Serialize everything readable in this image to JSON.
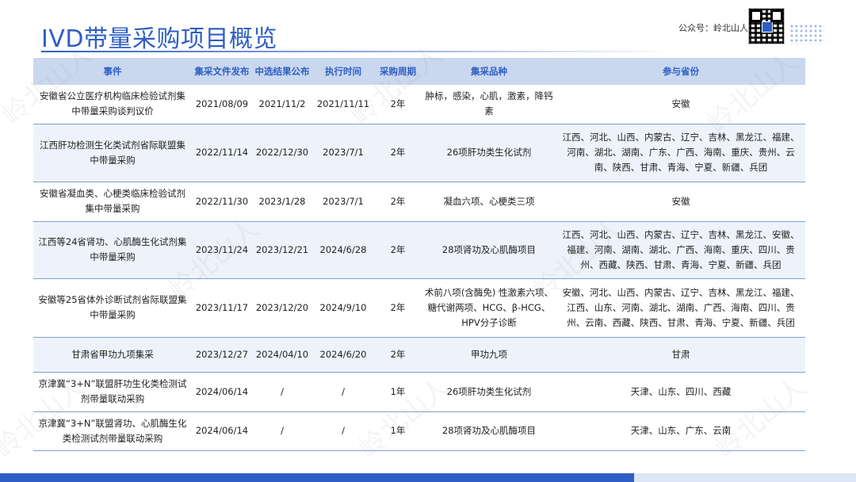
{
  "page": {
    "title": "IVD带量采购项目概览",
    "account_label": "公众号：岭北山人",
    "watermark": "岭北山人"
  },
  "table": {
    "headers": [
      "事件",
      "集采文件发布",
      "中选结果公布",
      "执行时间",
      "采购周期",
      "集采品种",
      "参与省份"
    ],
    "rows": [
      {
        "event": "安徽省公立医疗机构临床检验试剂集中带量采购谈判议价",
        "published": "2021/08/09",
        "result": "2021/11/2",
        "exec": "2021/11/11",
        "cycle": "2年",
        "items": "肿标，感染，心肌，激素，降钙素",
        "provinces": "安徽"
      },
      {
        "event": "江西肝功检测生化类试剂省际联盟集中带量采购",
        "published": "2022/11/14",
        "result": "2022/12/30",
        "exec": "2023/7/1",
        "cycle": "2年",
        "items": "26项肝功类生化试剂",
        "provinces": "江西、河北、山西、内蒙古、辽宁、吉林、黑龙江、福建、河南、湖北、湖南、广东、广西、海南、重庆、贵州、云南、陕西、甘肃、青海、宁夏、新疆、兵团"
      },
      {
        "event": "安徽省凝血类、心梗类临床检验试剂集中带量采购",
        "published": "2022/11/30",
        "result": "2023/1/28",
        "exec": "2023/7/1",
        "cycle": "2年",
        "items": "凝血六项、心梗类三项",
        "provinces": "安徽"
      },
      {
        "event": "江西等24省肾功、心肌酶生化试剂集中带量采购",
        "published": "2023/11/24",
        "result": "2023/12/21",
        "exec": "2024/6/28",
        "cycle": "2年",
        "items": "28项肾功及心肌酶项目",
        "provinces": "江西、河北、山西、内蒙古、辽宁、吉林、黑龙江、安徽、福建、河南、湖南、湖北、广西、海南、重庆、四川、贵州、西藏、陕西、甘肃、青海、宁夏、新疆、兵团"
      },
      {
        "event": "安徽等25省体外诊断试剂省际联盟集中带量采购",
        "published": "2023/11/17",
        "result": "2023/12/20",
        "exec": "2024/9/10",
        "cycle": "2年",
        "items": "术前八项(含酶免) 性激素六项、糖代谢两项、HCG、β-HCG、HPV分子诊断",
        "provinces": "安徽、河北、山西、内蒙古、辽宁、吉林、黑龙江、福建、江西、山东、河南、湖北、湖南、广西、海南、四川、贵州、云南、西藏、陕西、甘肃、青海、宁夏、新疆、兵团"
      },
      {
        "event": "甘肃省甲功九项集采",
        "published": "2023/12/27",
        "result": "2024/04/10",
        "exec": "2024/6/20",
        "cycle": "2年",
        "items": "甲功九项",
        "provinces": "甘肃"
      },
      {
        "event": "京津冀“3+N”联盟肝功生化类检测试剂带量联动采购",
        "published": "2024/06/14",
        "result": "/",
        "exec": "/",
        "cycle": "1年",
        "items": "26项肝功类生化试剂",
        "provinces": "天津、山东、四川、西藏"
      },
      {
        "event": "京津冀“3+N”联盟肾功、心肌酶生化类检测试剂带量联动采购",
        "published": "2024/06/14",
        "result": "/",
        "exec": "/",
        "cycle": "1年",
        "items": "28项肾功及心肌酶项目",
        "provinces": "天津、山东、广东、云南"
      }
    ]
  },
  "colors": {
    "accent": "#2F5FC4",
    "header_bg": "#C9D7EF",
    "row_alt_bg": "#EEF3FB"
  }
}
